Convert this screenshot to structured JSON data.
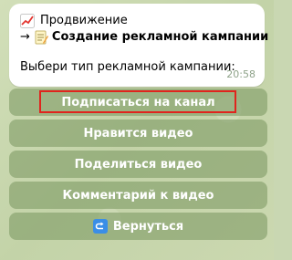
{
  "message": {
    "line1": "Продвижение",
    "line2_arrow": "→",
    "line2": "Создание рекламной кампании",
    "prompt": "Выбери тип рекламной кампании:",
    "time": "20:58",
    "icons": [
      "chart-up-icon",
      "memo-icon"
    ]
  },
  "keyboard": {
    "buttons": [
      {
        "label": "Подписаться на канал",
        "highlighted": true
      },
      {
        "label": "Нравится видео"
      },
      {
        "label": "Поделиться видео"
      },
      {
        "label": "Комментарий к видео"
      },
      {
        "label": "Вернуться",
        "icon": "back-arrow-icon"
      }
    ]
  },
  "colors": {
    "bubble": "#ffffff",
    "button_bg": "#7f9b62",
    "highlight": "#e0241d",
    "back_icon": "#3a8ee6"
  }
}
